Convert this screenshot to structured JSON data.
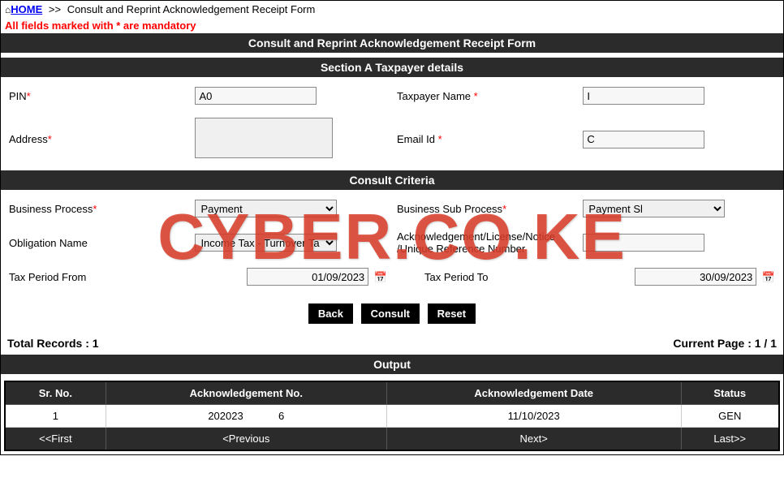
{
  "breadcrumb": {
    "home": "HOME",
    "current": "Consult and Reprint Acknowledgement Receipt Form"
  },
  "mandatory_note": "All fields marked with * are mandatory",
  "page_title": "Consult and Reprint Acknowledgement Receipt Form",
  "section_a": {
    "title": "Section A Taxpayer details",
    "pin_label": "PIN",
    "pin_value": "A0",
    "taxpayer_name_label": "Taxpayer Name ",
    "taxpayer_name_value": "I",
    "address_label": "Address",
    "address_value": "",
    "email_label": "Email Id ",
    "email_value": "C"
  },
  "consult_criteria": {
    "title": "Consult Criteria",
    "business_process_label": "Business Process",
    "business_process_value": "Payment",
    "business_sub_label": "Business Sub Process",
    "business_sub_value": "Payment Sl",
    "obligation_label": "Obligation Name",
    "obligation_value": "Income Tax - Turnover Ta",
    "ack_ref_label": "Acknowledgement/License/Notice /Unique Reference Number",
    "ack_ref_value": "",
    "tax_from_label": "Tax Period From",
    "tax_from_value": "01/09/2023",
    "tax_to_label": "Tax Period To",
    "tax_to_value": "30/09/2023"
  },
  "buttons": {
    "back": "Back",
    "consult": "Consult",
    "reset": "Reset"
  },
  "records": {
    "total_label": "Total Records : 1",
    "page_label": "Current Page : 1 / 1"
  },
  "output": {
    "title": "Output",
    "headers": {
      "srno": "Sr. No.",
      "ackno": "Acknowledgement No.",
      "ackdate": "Acknowledgement Date",
      "status": "Status"
    },
    "row": {
      "srno": "1",
      "ackno": "202023            6",
      "ackdate": "11/10/2023",
      "status": "GEN"
    },
    "nav": {
      "first": "<<First",
      "prev": "<Previous",
      "next": "Next>",
      "last": "Last>>"
    }
  },
  "watermark": "CYBER.CO.KE"
}
